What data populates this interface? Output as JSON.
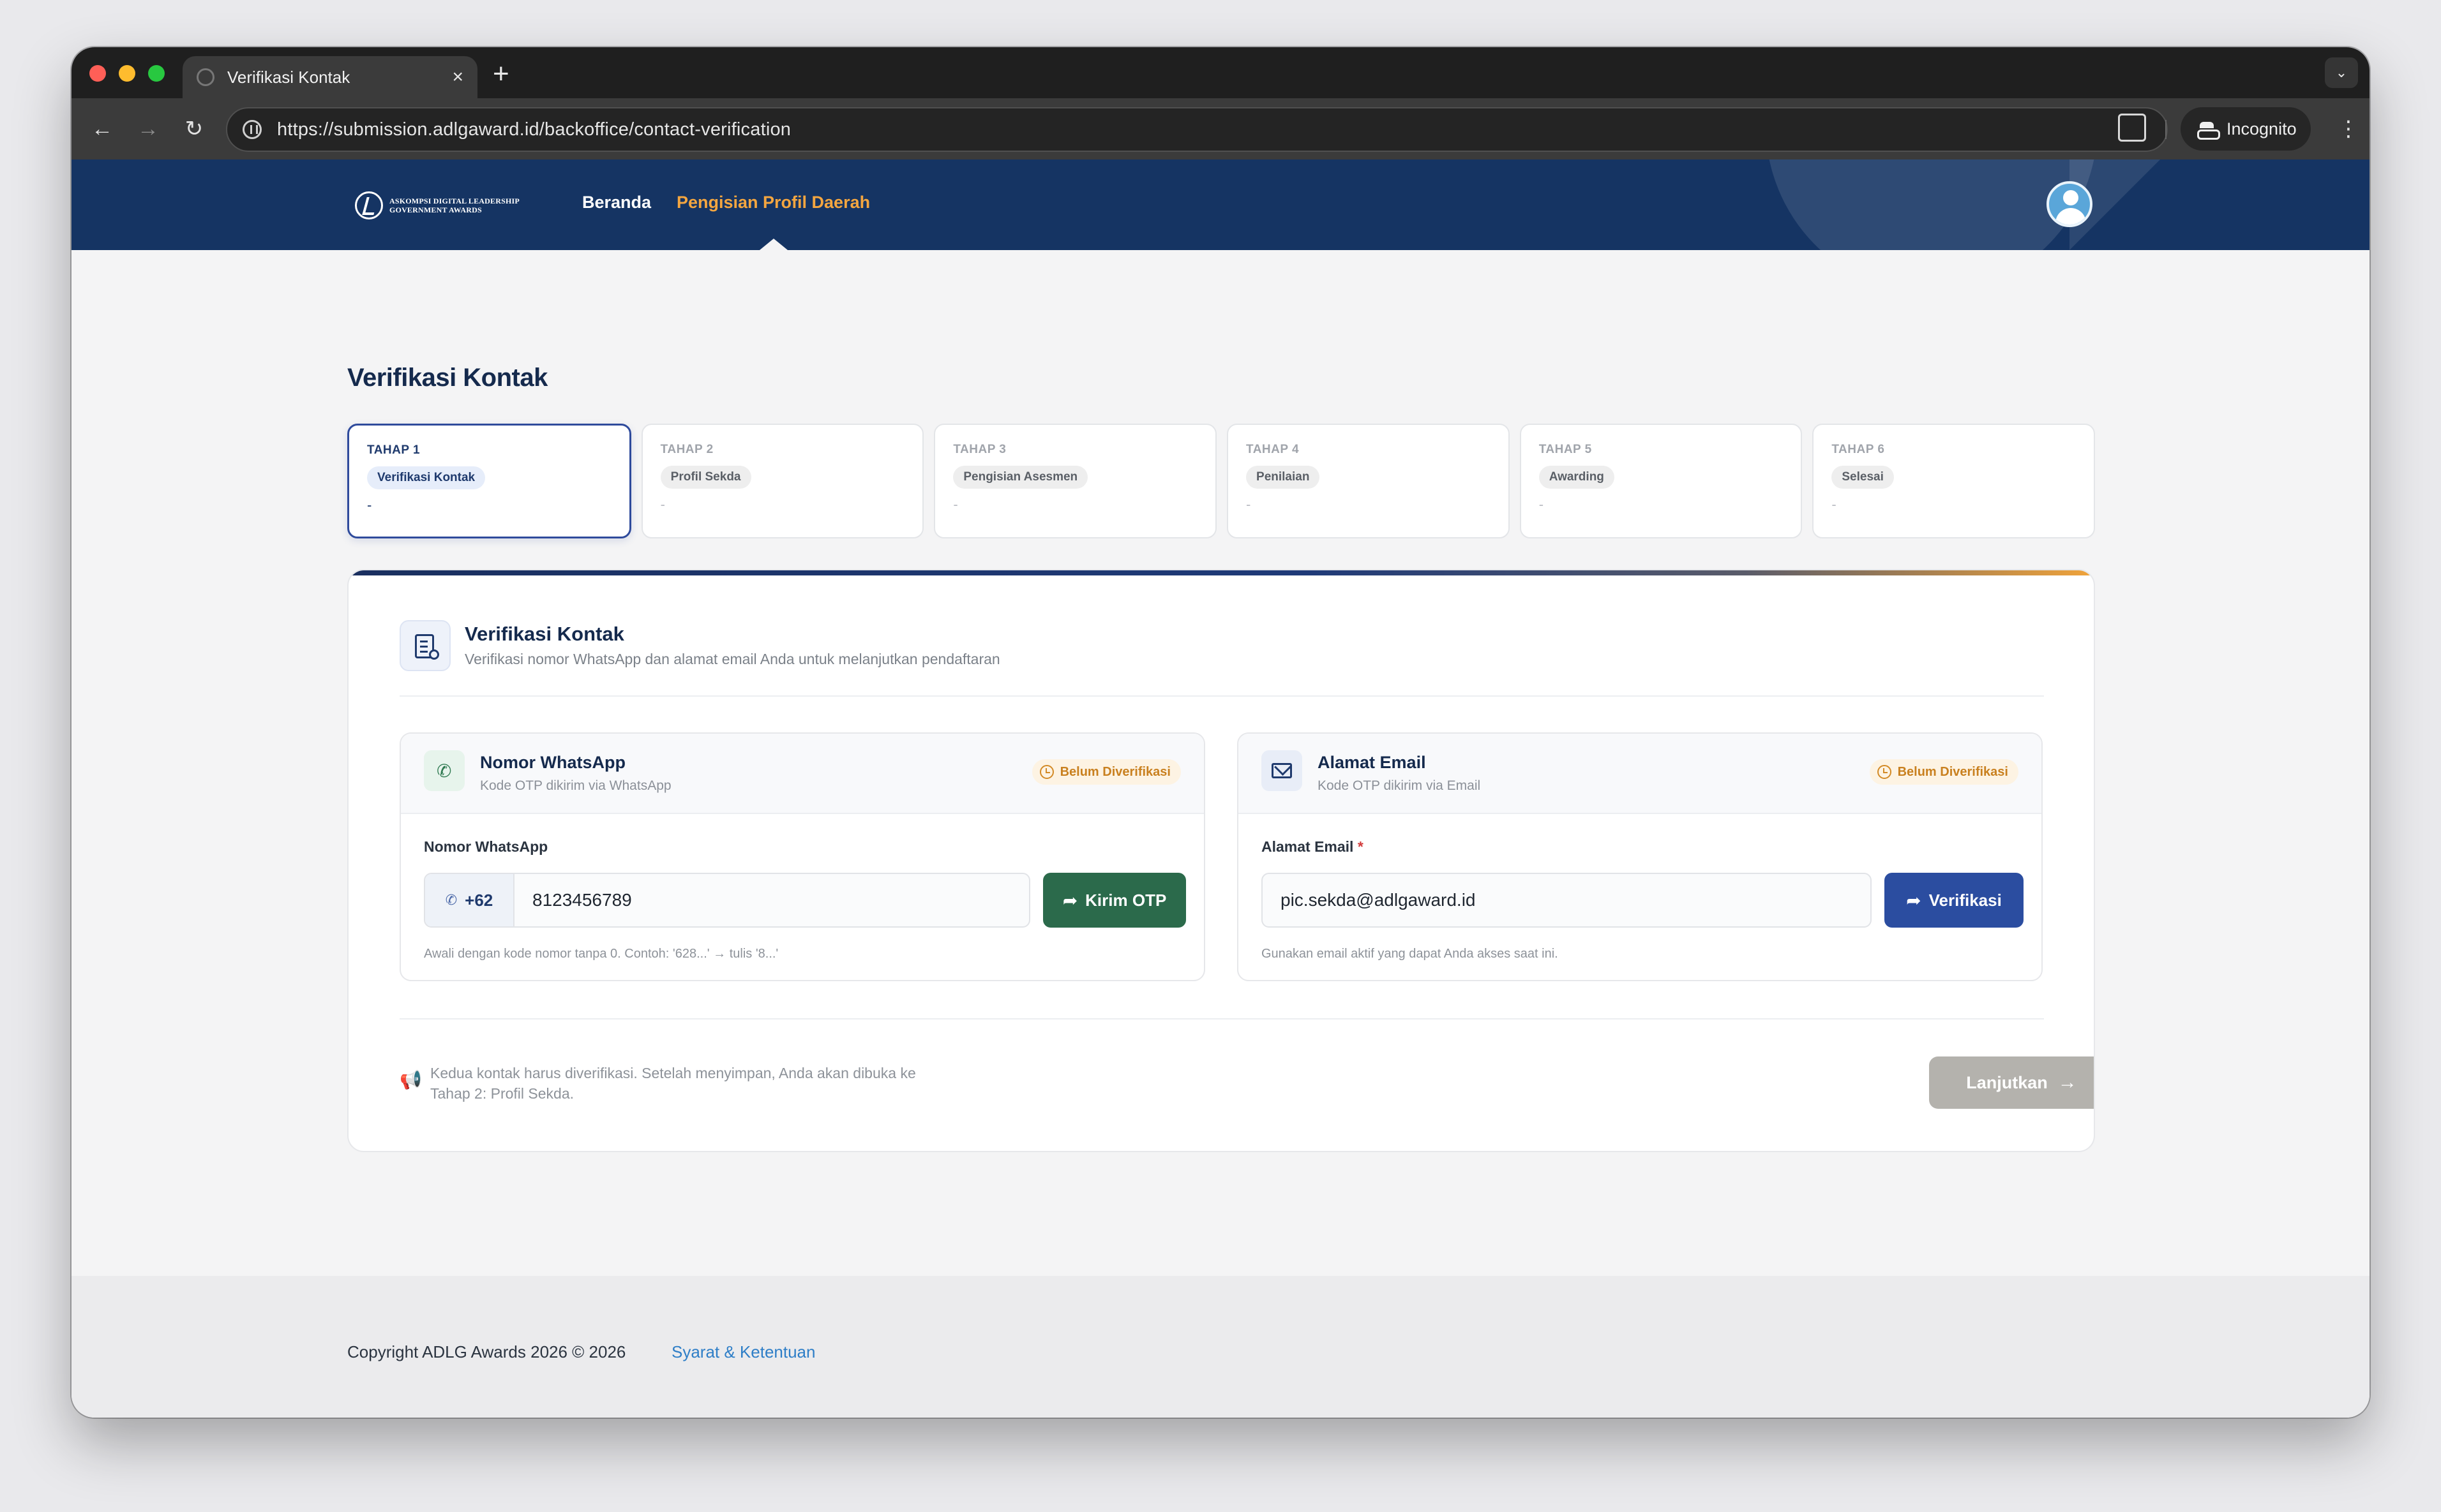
{
  "browser": {
    "tab_title": "Verifikasi Kontak",
    "new_tab_symbol": "+",
    "url": "https://submission.adlgaward.id/backoffice/contact-verification",
    "incognito_label": "Incognito"
  },
  "header": {
    "logo_line1": "ASKOMPSI DIGITAL LEADERSHIP",
    "logo_line2": "GOVERNMENT AWARDS",
    "nav": [
      {
        "label": "Beranda",
        "active": false
      },
      {
        "label": "Pengisian Profil Daerah",
        "active": true
      }
    ],
    "colors": {
      "primary": "#153463",
      "accent": "#f4a640"
    }
  },
  "page_title": "Verifikasi Kontak",
  "steps": [
    {
      "num": "TAHAP 1",
      "label": "Verifikasi Kontak",
      "status": "-",
      "active": true
    },
    {
      "num": "TAHAP 2",
      "label": "Profil Sekda",
      "status": "-",
      "active": false
    },
    {
      "num": "TAHAP 3",
      "label": "Pengisian Asesmen",
      "status": "-",
      "active": false
    },
    {
      "num": "TAHAP 4",
      "label": "Penilaian",
      "status": "-",
      "active": false
    },
    {
      "num": "TAHAP 5",
      "label": "Awarding",
      "status": "-",
      "active": false
    },
    {
      "num": "TAHAP 6",
      "label": "Selesai",
      "status": "-",
      "active": false
    }
  ],
  "card": {
    "title": "Verifikasi Kontak",
    "subtitle": "Verifikasi nomor WhatsApp dan alamat email Anda untuk melanjutkan pendaftaran"
  },
  "whatsapp": {
    "title": "Nomor WhatsApp",
    "subtitle": "Kode OTP dikirim via WhatsApp",
    "badge": "Belum Diverifikasi",
    "field_label": "Nomor WhatsApp",
    "prefix": "+62",
    "value": "8123456789",
    "button": "Kirim OTP",
    "hint": "Awali dengan kode nomor tanpa 0. Contoh: '628...' → tulis '8...'"
  },
  "email": {
    "title": "Alamat Email",
    "subtitle": "Kode OTP dikirim via Email",
    "badge": "Belum Diverifikasi",
    "field_label": "Alamat Email",
    "required_mark": "*",
    "value": "pic.sekda@adlgaward.id",
    "button": "Verifikasi",
    "hint": "Gunakan email aktif yang dapat Anda akses saat ini."
  },
  "footer_note": "Kedua kontak harus diverifikasi. Setelah menyimpan, Anda akan dibuka ke Tahap 2: Profil Sekda.",
  "next_button": "Lanjutkan",
  "footer": {
    "copyright": "Copyright ADLG Awards 2026 © 2026",
    "terms": "Syarat & Ketentuan"
  }
}
